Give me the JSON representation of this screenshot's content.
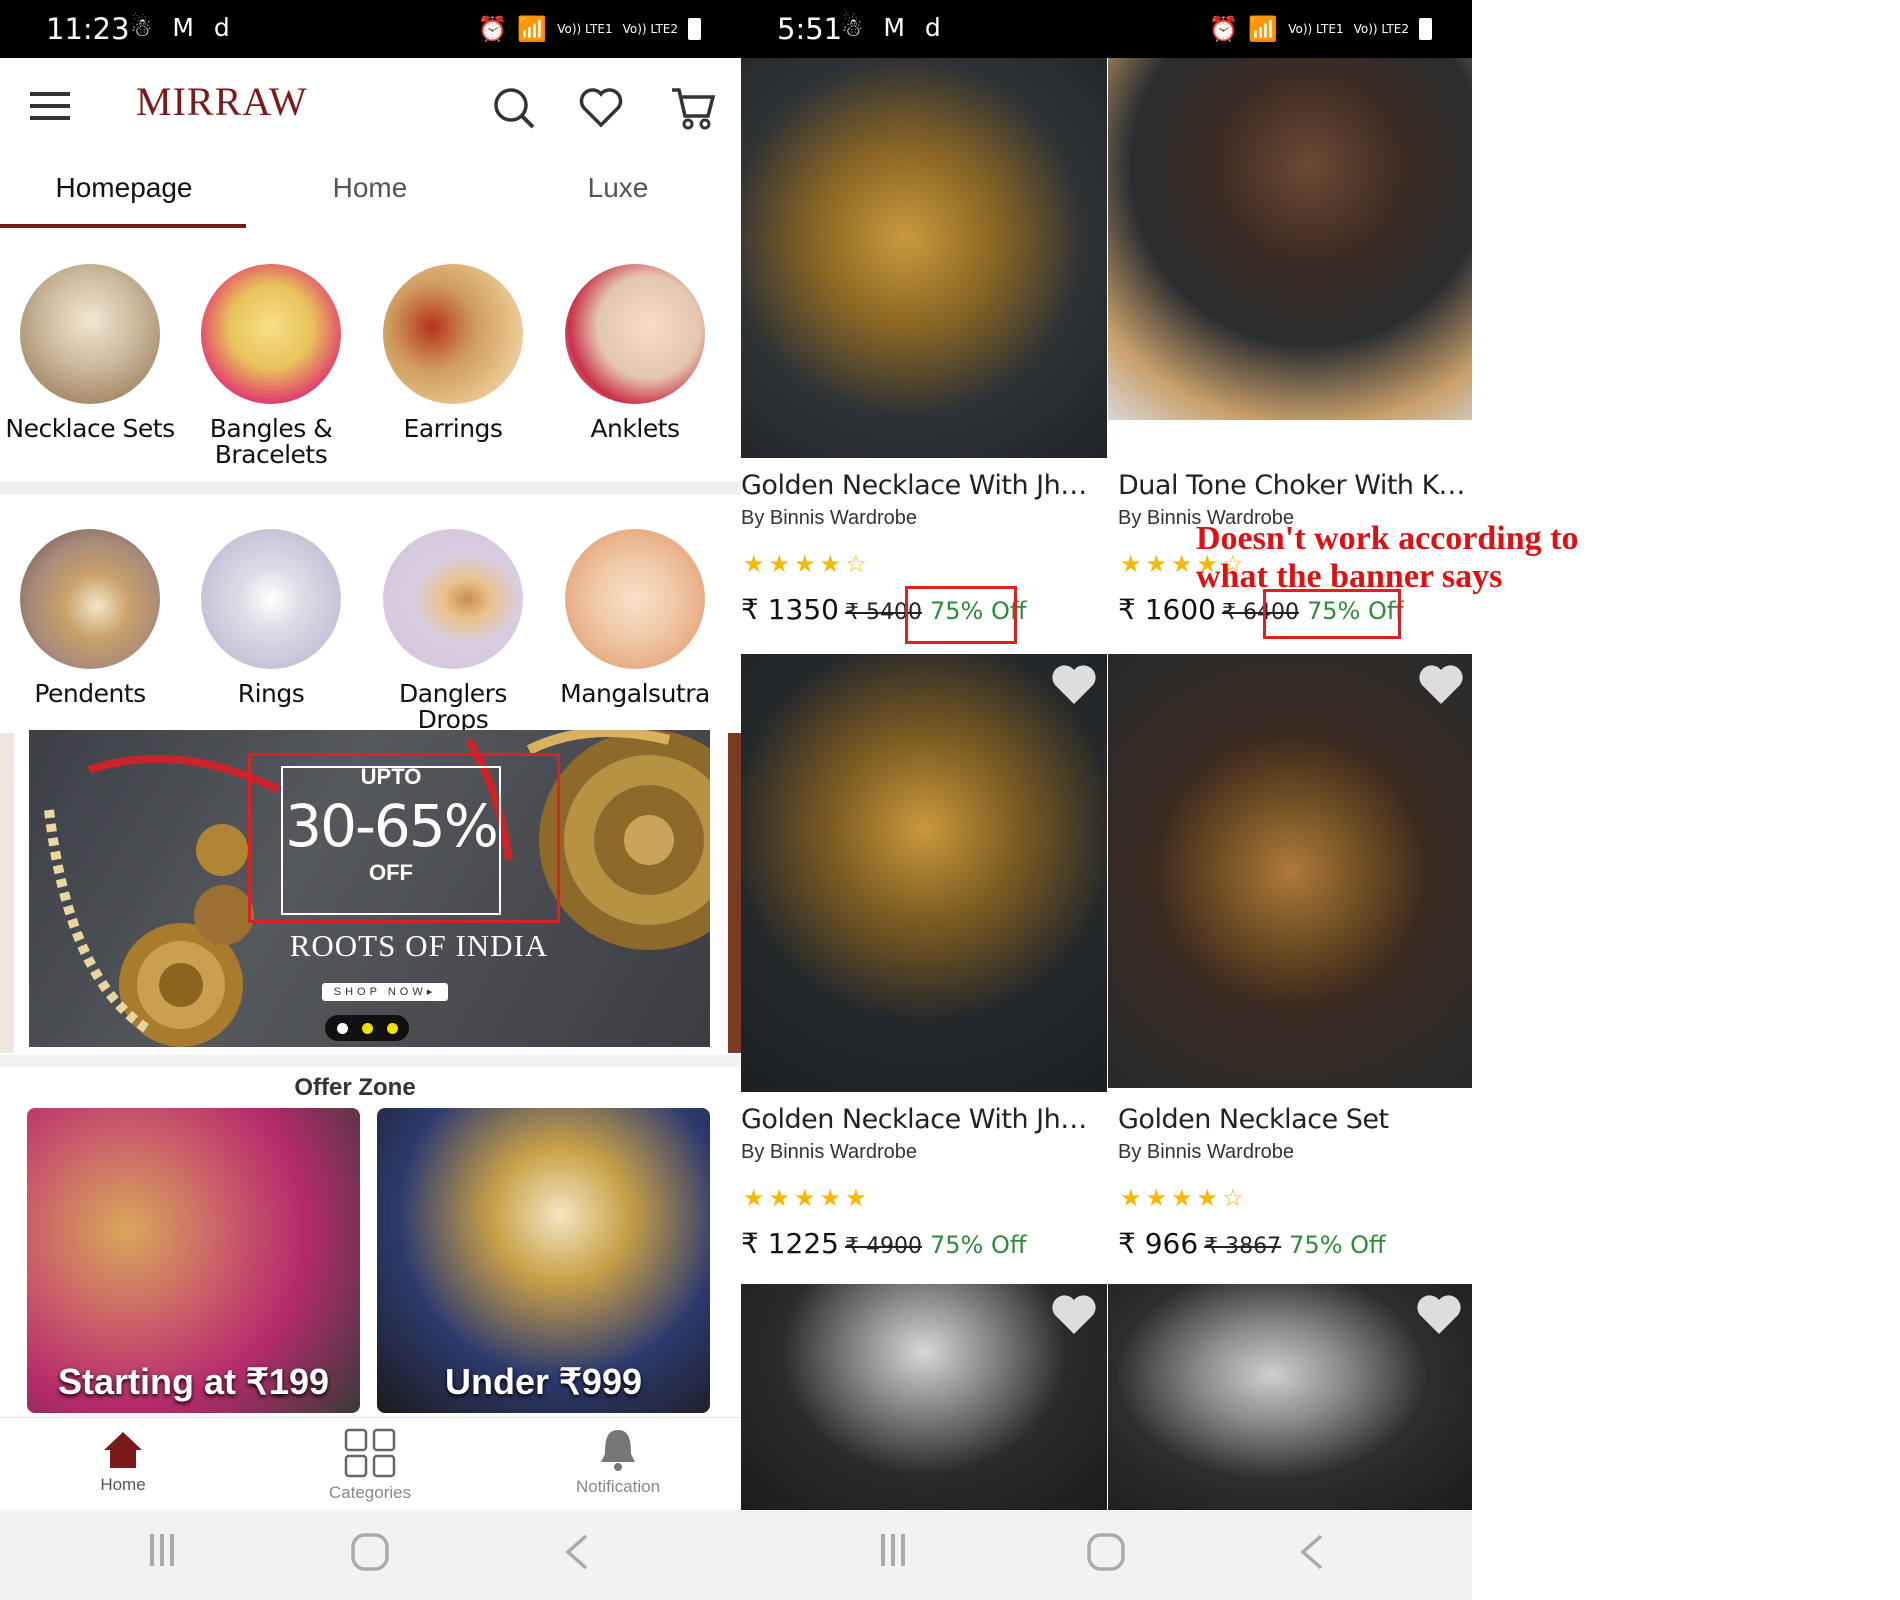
{
  "left_screen": {
    "status": {
      "time": "11:23",
      "left_icons": "☃ M d",
      "network1": "Vo)) LTE1",
      "network2": "Vo)) LTE2"
    },
    "logo": "MIRRAW",
    "tabs": [
      "Homepage",
      "Home",
      "Luxe"
    ],
    "categories_row1": [
      {
        "label": "Necklace Sets",
        "color": "#c9b79a"
      },
      {
        "label": "Bangles & Bracelets",
        "color": "#e9c25a"
      },
      {
        "label": "Earrings",
        "color": "#cf9a5c"
      },
      {
        "label": "Anklets",
        "color": "#e4c6b0"
      }
    ],
    "categories_row2": [
      {
        "label": "Pendents",
        "color": "#a88a7a"
      },
      {
        "label": "Rings",
        "color": "#cfc9dc"
      },
      {
        "label": "Danglers Drops",
        "color": "#d9cde0"
      },
      {
        "label": "Mangalsutra",
        "color": "#f1c9a8"
      }
    ],
    "banner": {
      "upto": "UPTO",
      "percent": "30-65%",
      "off": "OFF",
      "tagline": "ROOTS OF INDIA",
      "cta": "SHOP NOW▸"
    },
    "offer_zone": {
      "title": "Offer Zone",
      "cards": [
        "Starting at ₹199",
        "Under ₹999"
      ]
    },
    "bottom_nav": [
      "Home",
      "Categories",
      "Notification"
    ]
  },
  "right_screen": {
    "status": {
      "time": "5:51",
      "left_icons": "☃ M d",
      "network1": "Vo)) LTE1",
      "network2": "Vo)) LTE2"
    },
    "products": [
      {
        "title": "Golden Necklace With Jhu...",
        "by": "By Binnis Wardrobe",
        "stars": "★★★★☆",
        "price": "₹ 1350",
        "old": "₹ 5400",
        "off": "75% Off"
      },
      {
        "title": "Dual Tone Choker With Kar...",
        "by": "By Binnis Wardrobe",
        "stars": "★★★★☆",
        "price": "₹ 1600",
        "old": "₹ 6400",
        "off": "75% Off"
      },
      {
        "title": "Golden Necklace With Jhu...",
        "by": "By Binnis Wardrobe",
        "stars": "★★★★★",
        "price": "₹ 1225",
        "old": "₹ 4900",
        "off": "75% Off"
      },
      {
        "title": "Golden Necklace Set",
        "by": "By Binnis Wardrobe",
        "stars": "★★★★☆",
        "price": "₹ 966",
        "old": "₹ 3867",
        "off": "75% Off"
      }
    ]
  },
  "annotation": "Doesn't work according to what the banner says",
  "colors": {
    "brand": "#7a1a1a",
    "discount": "#2e8b3a",
    "highlight": "#e02020",
    "star": "#f6b800"
  }
}
